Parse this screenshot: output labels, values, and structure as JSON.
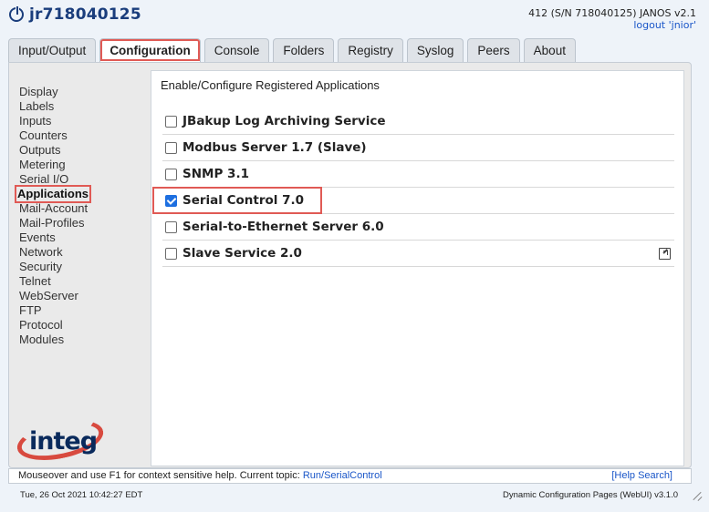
{
  "header": {
    "device_name": "jr718040125",
    "device_info": "412 (S/N 718040125) JANOS v2.1",
    "logout_label": "logout 'jnior'"
  },
  "tabs": [
    {
      "label": "Input/Output",
      "active": false
    },
    {
      "label": "Configuration",
      "active": true
    },
    {
      "label": "Console",
      "active": false
    },
    {
      "label": "Folders",
      "active": false
    },
    {
      "label": "Registry",
      "active": false
    },
    {
      "label": "Syslog",
      "active": false
    },
    {
      "label": "Peers",
      "active": false
    },
    {
      "label": "About",
      "active": false
    }
  ],
  "sidebar": {
    "items": [
      {
        "label": "Display"
      },
      {
        "label": "Labels"
      },
      {
        "label": "Inputs"
      },
      {
        "label": "Counters"
      },
      {
        "label": "Outputs"
      },
      {
        "label": "Metering"
      },
      {
        "label": "Serial I/O"
      },
      {
        "label": "Applications",
        "active": true
      },
      {
        "label": "Mail-Account"
      },
      {
        "label": "Mail-Profiles"
      },
      {
        "label": "Events"
      },
      {
        "label": "Network"
      },
      {
        "label": "Security"
      },
      {
        "label": "Telnet"
      },
      {
        "label": "WebServer"
      },
      {
        "label": "FTP"
      },
      {
        "label": "Protocol"
      },
      {
        "label": "Modules"
      }
    ]
  },
  "logo": {
    "text": "integ",
    "icon": "integ-logo"
  },
  "main": {
    "title": "Enable/Configure Registered Applications",
    "applications": [
      {
        "label": "JBakup Log Archiving Service",
        "checked": false
      },
      {
        "label": "Modbus Server 1.7 (Slave)",
        "checked": false
      },
      {
        "label": "SNMP 3.1",
        "checked": false
      },
      {
        "label": "Serial Control 7.0",
        "checked": true
      },
      {
        "label": "Serial-to-Ethernet Server 6.0",
        "checked": false
      },
      {
        "label": "Slave Service 2.0",
        "checked": false,
        "icon": "open-external-icon"
      }
    ]
  },
  "help": {
    "text": "Mouseover and use F1 for context sensitive help. Current topic: ",
    "topic": "Run/SerialControl",
    "search_label": "[Help Search]"
  },
  "footer": {
    "timestamp": "Tue, 26 Oct 2021 10:42:27 EDT",
    "version": "Dynamic Configuration Pages (WebUI) v3.1.0"
  },
  "colors": {
    "accent": "#1a3d7c",
    "highlight": "#e05a55",
    "link": "#1a56c8",
    "checkbox": "#1d6fe0"
  }
}
